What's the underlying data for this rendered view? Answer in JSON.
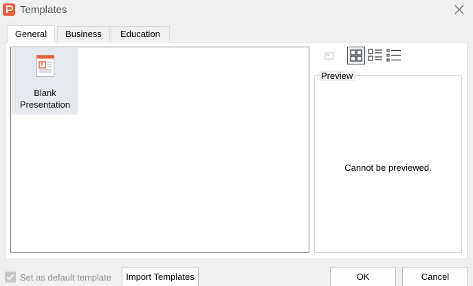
{
  "window": {
    "title": "Templates",
    "app_icon": "presentation-app-icon",
    "close_icon": "close-icon",
    "accent_color": "#e8603c"
  },
  "tabs": [
    {
      "label": "General",
      "active": true
    },
    {
      "label": "Business",
      "active": false
    },
    {
      "label": "Education",
      "active": false
    }
  ],
  "templates": [
    {
      "label": "Blank\nPresentation",
      "icon": "blank-presentation-icon",
      "selected": true
    }
  ],
  "view_toolbar": {
    "import_icon": "add-image-icon",
    "large_icons_icon": "large-icons-view-icon",
    "list_icon": "list-view-icon",
    "details_icon": "details-view-icon",
    "active_view": "large-icons"
  },
  "preview": {
    "legend": "Preview",
    "message": "Cannot be previewed."
  },
  "footer": {
    "default_checkbox_label": "Set as default template",
    "default_checkbox_checked": true,
    "default_checkbox_enabled": false,
    "import_button": "Import Templates",
    "ok_button": "OK",
    "cancel_button": "Cancel"
  }
}
